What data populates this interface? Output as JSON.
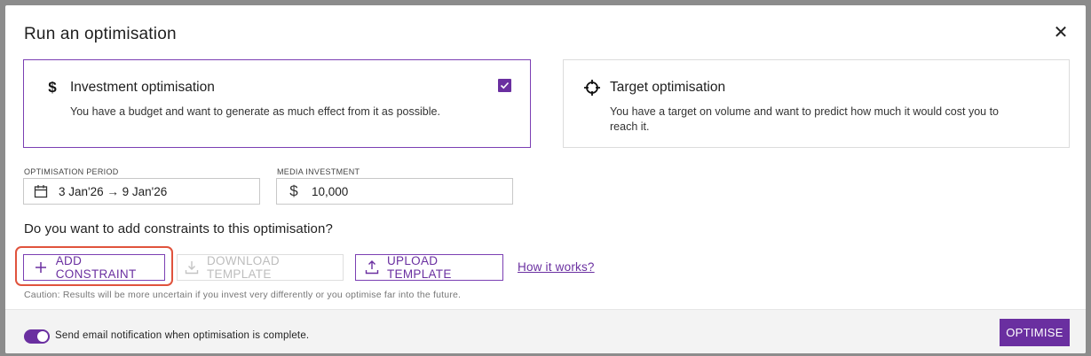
{
  "dialog": {
    "title": "Run an optimisation",
    "close_icon": "close-icon"
  },
  "cards": {
    "investment": {
      "icon": "dollar-icon",
      "title": "Investment optimisation",
      "description": "You have a budget and want to generate as much effect from it as possible.",
      "selected": true
    },
    "target": {
      "icon": "crosshair-icon",
      "title": "Target optimisation",
      "description": "You have a target on volume and want to predict how much it would cost you to reach it.",
      "selected": false
    }
  },
  "fields": {
    "period": {
      "label": "OPTIMISATION PERIOD",
      "value": "3 Jan'26 → 9 Jan'26",
      "icon": "calendar-icon"
    },
    "investment": {
      "label": "MEDIA INVESTMENT",
      "value": "10,000",
      "icon": "dollar-icon"
    }
  },
  "constraints": {
    "question": "Do you want to add constraints to this optimisation?",
    "add_label": "ADD CONSTRAINT",
    "download_label": "DOWNLOAD TEMPLATE",
    "upload_label": "UPLOAD TEMPLATE",
    "how_label": "How it works?",
    "caution": "Caution: Results will be more uncertain if you invest very differently or you optimise far into the future."
  },
  "footer": {
    "notification_label": "Send email notification when optimisation is complete.",
    "notification_enabled": true,
    "optimise_label": "OPTIMISE"
  },
  "colors": {
    "accent": "#6a2fa0",
    "highlight": "#e0533d"
  }
}
